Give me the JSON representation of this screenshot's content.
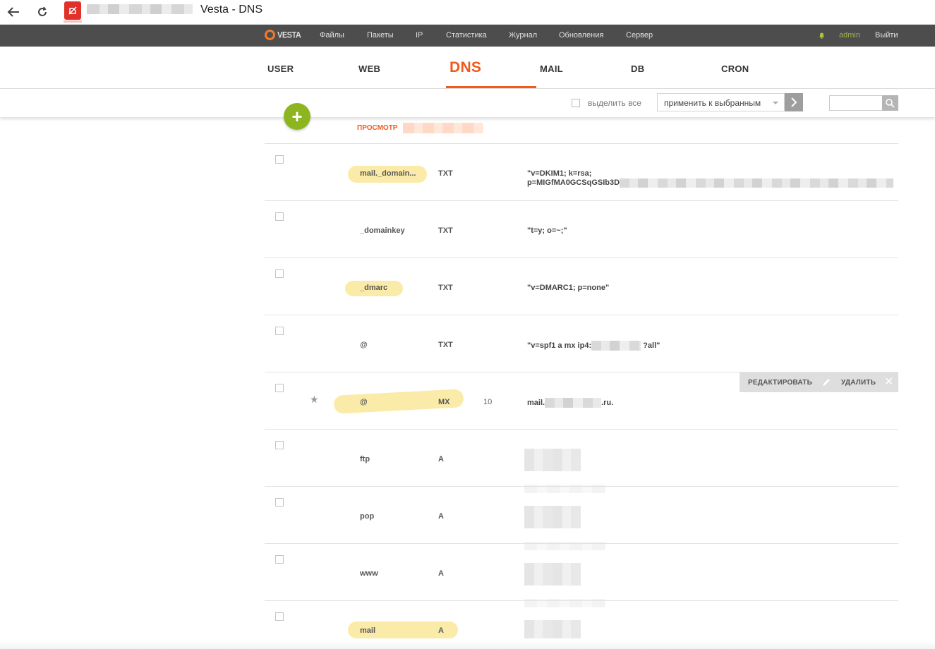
{
  "browser": {
    "tab_title": "Vesta - DNS"
  },
  "topnav": {
    "logo": "VESTA",
    "items": [
      "Файлы",
      "Пакеты",
      "IP",
      "Статистика",
      "Журнал",
      "Обновления",
      "Сервер"
    ],
    "user": "admin",
    "logout": "Выйти"
  },
  "sections": [
    "USER",
    "WEB",
    "DNS",
    "MAIL",
    "DB",
    "CRON"
  ],
  "active_section": "DNS",
  "toolbar": {
    "select_all": "выделить все",
    "bulk_action": "применить к выбранным"
  },
  "view_label": "ПРОСМОТР",
  "row_actions": {
    "edit": "РЕДАКТИРОВАТЬ",
    "delete": "УДАЛИТЬ"
  },
  "records": [
    {
      "name": "mail._domain...",
      "type": "TXT",
      "priority": "",
      "value_line1": "\"v=DKIM1; k=rsa;",
      "value_line2": "p=MIGfMA0GCSqGSIb3D",
      "highlight": true
    },
    {
      "name": "_domainkey",
      "type": "TXT",
      "priority": "",
      "value_line1": "\"t=y; o=~;\"",
      "highlight": false
    },
    {
      "name": "_dmarc",
      "type": "TXT",
      "priority": "",
      "value_line1": "\"v=DMARC1; p=none\"",
      "highlight": true
    },
    {
      "name": "@",
      "type": "TXT",
      "priority": "",
      "value_prefix": "\"v=spf1 a mx ip4:",
      "value_suffix": " ?all\"",
      "highlight": false
    },
    {
      "name": "@",
      "type": "MX",
      "priority": "10",
      "value_prefix": "mail.",
      "value_suffix": ".ru.",
      "highlight": true,
      "starred": true
    },
    {
      "name": "ftp",
      "type": "A",
      "priority": "",
      "highlight": false
    },
    {
      "name": "pop",
      "type": "A",
      "priority": "",
      "highlight": false
    },
    {
      "name": "www",
      "type": "A",
      "priority": "",
      "highlight": false
    },
    {
      "name": "mail",
      "type": "A",
      "priority": "",
      "highlight": true
    }
  ],
  "colors": {
    "accent": "#f05a1a",
    "topnav_bg": "#4d4d4d",
    "add_button": "#8cb51f",
    "highlight": "#fbe9a0"
  }
}
